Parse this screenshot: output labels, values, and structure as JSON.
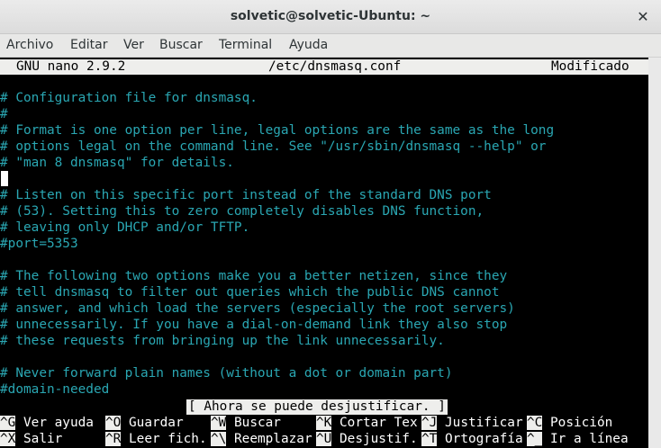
{
  "window": {
    "title": "solvetic@solvetic-Ubuntu: ~"
  },
  "menu": [
    "Archivo",
    "Editar",
    "Ver",
    "Buscar",
    "Terminal",
    "Ayuda"
  ],
  "nano": {
    "version": "GNU nano 2.9.2",
    "filename": "/etc/dnsmasq.conf",
    "state": "Modificado",
    "lines": [
      "# Configuration file for dnsmasq.",
      "#",
      "# Format is one option per line, legal options are the same as the long",
      "# options legal on the command line. See \"/usr/sbin/dnsmasq --help\" or",
      "# \"man 8 dnsmasq\" for details.",
      "",
      "# Listen on this specific port instead of the standard DNS port",
      "# (53). Setting this to zero completely disables DNS function,",
      "# leaving only DHCP and/or TFTP.",
      "#port=5353",
      "",
      "# The following two options make you a better netizen, since they",
      "# tell dnsmasq to filter out queries which the public DNS cannot",
      "# answer, and which load the servers (especially the root servers)",
      "# unnecessarily. If you have a dial-on-demand link they also stop",
      "# these requests from bringing up the link unnecessarily.",
      "",
      "# Never forward plain names (without a dot or domain part)",
      "#domain-needed"
    ],
    "status_message": "[ Ahora se puede desjustificar. ]",
    "shortcuts_row1": [
      {
        "key": "^G",
        "label": " Ver ayuda"
      },
      {
        "key": "^O",
        "label": " Guardar"
      },
      {
        "key": "^W",
        "label": " Buscar"
      },
      {
        "key": "^K",
        "label": " Cortar Tex"
      },
      {
        "key": "^J",
        "label": " Justificar"
      },
      {
        "key": "^C",
        "label": " Posición"
      }
    ],
    "shortcuts_row2": [
      {
        "key": "^X",
        "label": " Salir"
      },
      {
        "key": "^R",
        "label": " Leer fich."
      },
      {
        "key": "^\\",
        "label": " Reemplazar"
      },
      {
        "key": "^U",
        "label": " Desjustif."
      },
      {
        "key": "^T",
        "label": " Ortografía"
      },
      {
        "key": "^_",
        "label": " Ir a línea"
      }
    ]
  },
  "colors": {
    "comment_text": "#2aa7b3",
    "terminal_bg": "#000000",
    "bar_bg": "#eeeeec"
  }
}
